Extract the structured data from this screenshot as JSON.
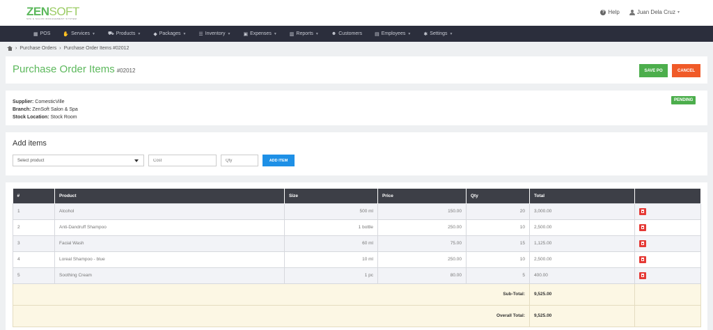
{
  "brand": {
    "name_part1": "ZEN",
    "name_part2": "SOFT",
    "tagline": "SPA & SALON MANAGEMENT SYSTEM"
  },
  "topbar": {
    "help_label": "Help",
    "user_name": "Juan Dela Cruz"
  },
  "nav": [
    {
      "label": "POS",
      "icon": "pos-icon",
      "glyph": "▦",
      "dropdown": false
    },
    {
      "label": "Services",
      "icon": "services-icon",
      "glyph": "✋",
      "dropdown": true
    },
    {
      "label": "Products",
      "icon": "cart-icon",
      "glyph": "⛟",
      "dropdown": true
    },
    {
      "label": "Packages",
      "icon": "tag-icon",
      "glyph": "◆",
      "dropdown": true
    },
    {
      "label": "Inventory",
      "icon": "list-icon",
      "glyph": "☰",
      "dropdown": true
    },
    {
      "label": "Expenses",
      "icon": "expenses-icon",
      "glyph": "▣",
      "dropdown": true
    },
    {
      "label": "Reports",
      "icon": "bar-chart-icon",
      "glyph": "▥",
      "dropdown": true
    },
    {
      "label": "Customers",
      "icon": "users-icon",
      "glyph": "☻",
      "dropdown": false
    },
    {
      "label": "Employees",
      "icon": "briefcase-icon",
      "glyph": "▤",
      "dropdown": true
    },
    {
      "label": "Settings",
      "icon": "gear-icon",
      "glyph": "✱",
      "dropdown": true
    }
  ],
  "breadcrumb": {
    "parent": "Purchase Orders",
    "current": "Purchase Order Items #02012"
  },
  "header": {
    "title": "Purchase Order Items",
    "po_number": "#02012",
    "save_label": "SAVE PO",
    "cancel_label": "CANCEL"
  },
  "info": {
    "supplier_label": "Supplier:",
    "supplier": "ComesticVille",
    "branch_label": "Branch:",
    "branch": "ZenSoft Salon & Spa",
    "location_label": "Stock Location:",
    "location": "Stock Room",
    "status": "PENDING"
  },
  "add_items": {
    "title": "Add items",
    "product_placeholder": "Select product",
    "cost_placeholder": "Cost",
    "qty_placeholder": "Qty",
    "add_label": "ADD ITEM"
  },
  "table": {
    "headers": [
      "#",
      "Product",
      "Size",
      "Price",
      "Qty",
      "Total",
      ""
    ],
    "rows": [
      {
        "no": "1",
        "product": "Alcohol",
        "size": "500 ml",
        "price": "150.00",
        "qty": "20",
        "total": "3,000.00"
      },
      {
        "no": "2",
        "product": "Anti-Dandruff Shampoo",
        "size": "1 bottle",
        "price": "250.00",
        "qty": "10",
        "total": "2,500.00"
      },
      {
        "no": "3",
        "product": "Facial Wash",
        "size": "60 ml",
        "price": "75.00",
        "qty": "15",
        "total": "1,125.00"
      },
      {
        "no": "4",
        "product": "Loreal Shampoo - blue",
        "size": "10 ml",
        "price": "250.00",
        "qty": "10",
        "total": "2,500.00"
      },
      {
        "no": "5",
        "product": "Soothing Cream",
        "size": "1 pc",
        "price": "80.00",
        "qty": "5",
        "total": "400.00"
      }
    ],
    "subtotal_label": "Sub-Total:",
    "subtotal": "9,525.00",
    "overall_label": "Overall Total:",
    "overall": "9,525.00"
  }
}
